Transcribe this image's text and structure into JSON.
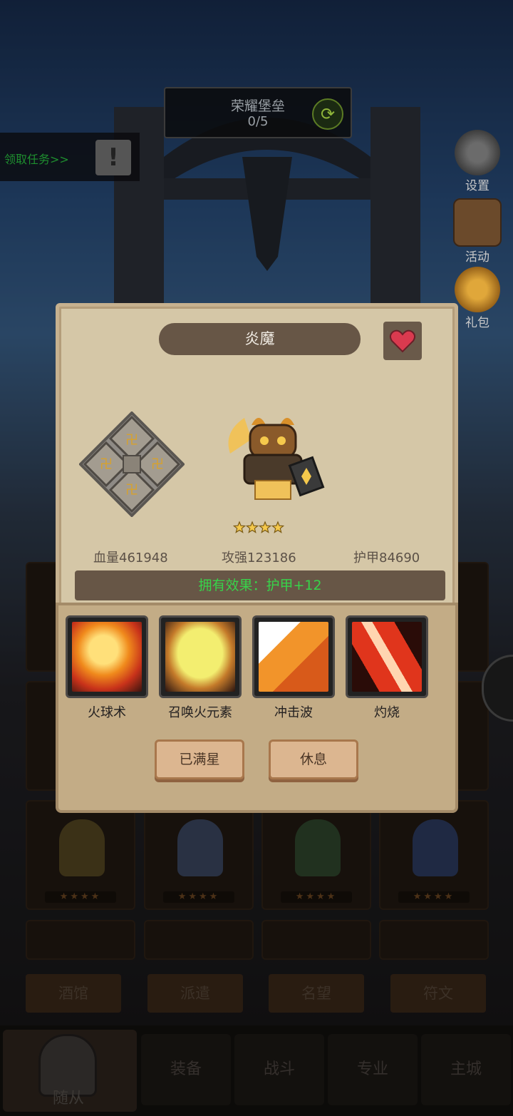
{
  "hud": {
    "location_title": "荣耀堡垒",
    "location_progress": "0/5",
    "task_link": "领取任务>>",
    "side_buttons": [
      {
        "label": "设置",
        "icon": "gear-icon"
      },
      {
        "label": "活动",
        "icon": "book-icon"
      },
      {
        "label": "礼包",
        "icon": "gift-icon"
      }
    ]
  },
  "hero_modal": {
    "name": "炎魔",
    "star_count": 4,
    "stats": {
      "hp": "血量461948",
      "attack": "攻强123186",
      "armor": "护甲84690"
    },
    "effect": "拥有效果：护甲+12",
    "skills": [
      {
        "name": "火球术",
        "icon": "fireball-icon"
      },
      {
        "name": "召唤火元素",
        "icon": "fire-elemental-icon"
      },
      {
        "name": "冲击波",
        "icon": "shockwave-icon"
      },
      {
        "name": "灼烧",
        "icon": "burn-icon"
      }
    ],
    "buttons": {
      "max_star": "已满星",
      "rest": "休息"
    }
  },
  "sub_tabs": [
    "酒馆",
    "派遣",
    "名望",
    "符文"
  ],
  "bottom_tabs": {
    "active": "随从",
    "others": [
      "装备",
      "战斗",
      "专业",
      "主城"
    ]
  }
}
